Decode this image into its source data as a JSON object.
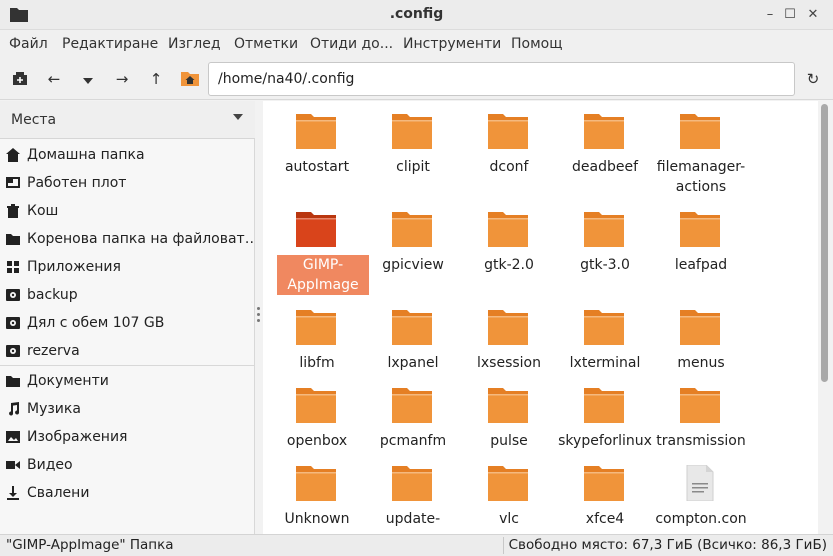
{
  "window": {
    "title": ".config",
    "minimize": "–",
    "maximize": "☐",
    "close": "✕"
  },
  "menubar": [
    "Файл",
    "Редактиране",
    "Изглед",
    "Отметки",
    "Отиди до...",
    "Инструменти",
    "Помощ"
  ],
  "toolbar": {
    "path": "/home/na40/.config"
  },
  "sidebar": {
    "header": "Места",
    "groups": [
      [
        "Домашна папка",
        "Работен плот",
        "Кош",
        "Коренова папка на файловат…",
        "Приложения",
        "backup",
        "Дял с обем 107 GB",
        "rezerva"
      ],
      [
        "Документи",
        "Музика",
        "Изображения",
        "Видео",
        "Свалени"
      ]
    ],
    "icons": [
      [
        "home-icon",
        "desktop-icon",
        "trash-icon",
        "folder-icon",
        "apps-icon",
        "drive-icon",
        "drive-icon",
        "drive-icon"
      ],
      [
        "documents-icon",
        "music-icon",
        "pictures-icon",
        "video-icon",
        "download-icon"
      ]
    ]
  },
  "files": [
    {
      "name": "autostart",
      "type": "folder"
    },
    {
      "name": "clipit",
      "type": "folder"
    },
    {
      "name": "dconf",
      "type": "folder"
    },
    {
      "name": "deadbeef",
      "type": "folder"
    },
    {
      "name": "filemanager-actions",
      "type": "folder"
    },
    {
      "name": "GIMP-AppImage",
      "type": "folder",
      "selected": true
    },
    {
      "name": "gpicview",
      "type": "folder"
    },
    {
      "name": "gtk-2.0",
      "type": "folder"
    },
    {
      "name": "gtk-3.0",
      "type": "folder"
    },
    {
      "name": "leafpad",
      "type": "folder"
    },
    {
      "name": "libfm",
      "type": "folder"
    },
    {
      "name": "lxpanel",
      "type": "folder"
    },
    {
      "name": "lxsession",
      "type": "folder"
    },
    {
      "name": "lxterminal",
      "type": "folder"
    },
    {
      "name": "menus",
      "type": "folder"
    },
    {
      "name": "openbox",
      "type": "folder"
    },
    {
      "name": "pcmanfm",
      "type": "folder"
    },
    {
      "name": "pulse",
      "type": "folder"
    },
    {
      "name": "skypeforlinux",
      "type": "folder"
    },
    {
      "name": "transmission",
      "type": "folder"
    },
    {
      "name": "Unknown",
      "type": "folder"
    },
    {
      "name": "update-",
      "type": "folder"
    },
    {
      "name": "vlc",
      "type": "folder"
    },
    {
      "name": "xfce4",
      "type": "folder"
    },
    {
      "name": "compton.con",
      "type": "file"
    }
  ],
  "status": {
    "selection": "\"GIMP-AppImage\" Папка",
    "free_space": "Свободно място: 67,3 ГиБ (Всичко: 86,3 ГиБ)"
  },
  "colors": {
    "folder": "#f0943a",
    "folder_tab": "#e57f24",
    "folder_selected": "#d9441b",
    "selection_bg": "#f08860"
  }
}
